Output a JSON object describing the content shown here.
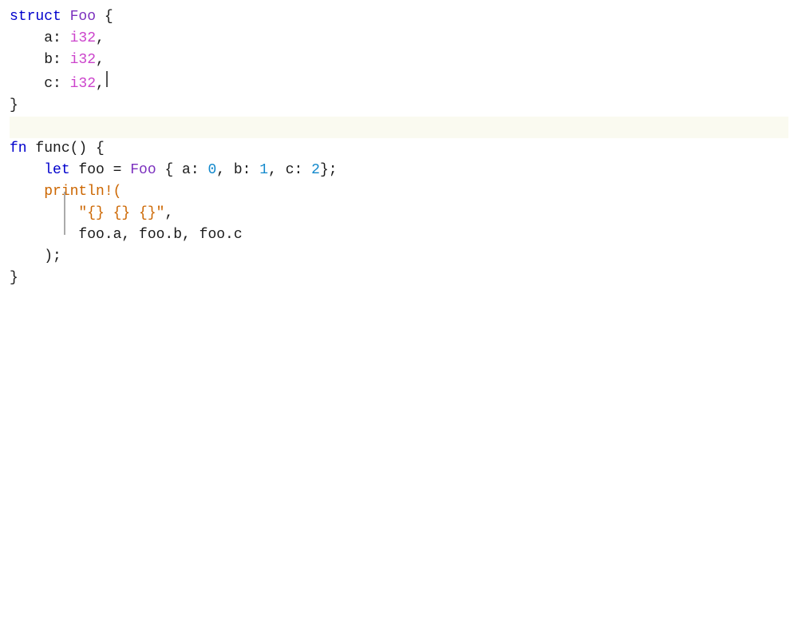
{
  "editor": {
    "background": "#ffffff",
    "highlight_line_bg": "#fafaf0",
    "lines": [
      {
        "id": "line-struct",
        "tokens": [
          {
            "type": "kw",
            "text": "struct"
          },
          {
            "type": "plain",
            "text": " "
          },
          {
            "type": "type-name",
            "text": "Foo"
          },
          {
            "type": "plain",
            "text": " {"
          }
        ],
        "highlighted": false
      },
      {
        "id": "line-field-a",
        "tokens": [
          {
            "type": "plain",
            "text": "    a: "
          },
          {
            "type": "type-kw",
            "text": "i32"
          },
          {
            "type": "plain",
            "text": ","
          }
        ],
        "highlighted": false
      },
      {
        "id": "line-field-b",
        "tokens": [
          {
            "type": "plain",
            "text": "    b: "
          },
          {
            "type": "type-kw",
            "text": "i32"
          },
          {
            "type": "plain",
            "text": ","
          }
        ],
        "highlighted": false
      },
      {
        "id": "line-field-c",
        "tokens": [
          {
            "type": "plain",
            "text": "    c: "
          },
          {
            "type": "type-kw",
            "text": "i32"
          },
          {
            "type": "plain",
            "text": ","
          }
        ],
        "highlighted": false
      },
      {
        "id": "line-struct-close",
        "tokens": [
          {
            "type": "plain",
            "text": "}"
          }
        ],
        "highlighted": false
      },
      {
        "id": "line-blank1",
        "tokens": [],
        "highlighted": true
      },
      {
        "id": "line-fn",
        "tokens": [
          {
            "type": "kw",
            "text": "fn"
          },
          {
            "type": "plain",
            "text": " func() {"
          }
        ],
        "highlighted": false
      },
      {
        "id": "line-let",
        "tokens": [
          {
            "type": "plain",
            "text": "    "
          },
          {
            "type": "kw",
            "text": "let"
          },
          {
            "type": "plain",
            "text": " foo = "
          },
          {
            "type": "type-name",
            "text": "Foo"
          },
          {
            "type": "plain",
            "text": " { a: "
          },
          {
            "type": "number",
            "text": "0"
          },
          {
            "type": "plain",
            "text": ", b: "
          },
          {
            "type": "number",
            "text": "1"
          },
          {
            "type": "plain",
            "text": ", c: "
          },
          {
            "type": "number",
            "text": "2"
          },
          {
            "type": "plain",
            "text": "};"
          }
        ],
        "highlighted": false
      },
      {
        "id": "line-println",
        "tokens": [
          {
            "type": "plain",
            "text": "    "
          },
          {
            "type": "macro",
            "text": "println!("
          }
        ],
        "highlighted": false,
        "has_bar": false
      },
      {
        "id": "line-format-str",
        "tokens": [
          {
            "type": "plain",
            "text": "        "
          },
          {
            "type": "string",
            "text": "\"{} {} {}\""
          },
          {
            "type": "plain",
            "text": ","
          }
        ],
        "highlighted": false,
        "has_bar": true
      },
      {
        "id": "line-args",
        "tokens": [
          {
            "type": "plain",
            "text": "        foo.a, foo.b, foo.c"
          }
        ],
        "highlighted": false,
        "has_bar": true
      },
      {
        "id": "line-println-close",
        "tokens": [
          {
            "type": "plain",
            "text": "    );"
          }
        ],
        "highlighted": false
      },
      {
        "id": "line-fn-close",
        "tokens": [
          {
            "type": "plain",
            "text": "}"
          }
        ],
        "highlighted": false
      }
    ]
  }
}
